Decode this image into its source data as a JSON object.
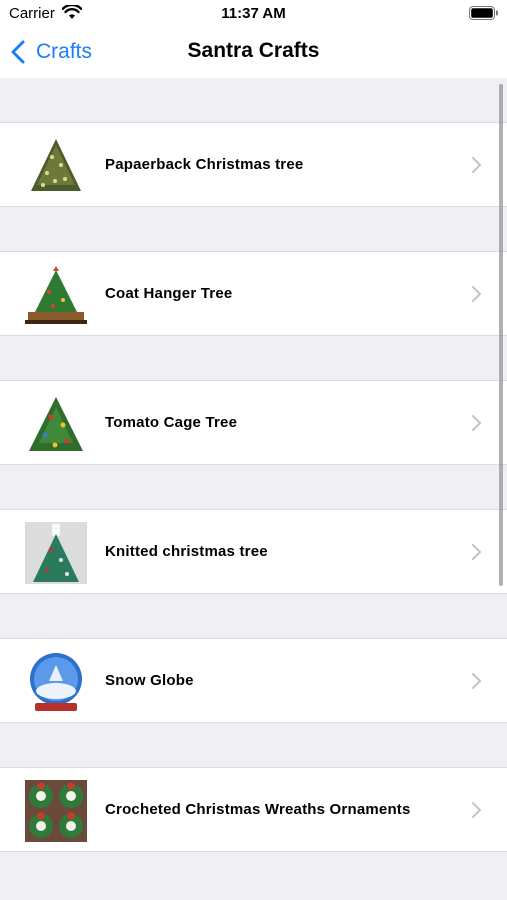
{
  "status_bar": {
    "carrier": "Carrier",
    "time": "11:37 AM"
  },
  "nav": {
    "back_label": "Crafts",
    "title": "Santra Crafts"
  },
  "items": [
    {
      "label": "Papaerback Christmas tree",
      "thumb_icon": "paperback-tree-icon"
    },
    {
      "label": "Coat Hanger Tree",
      "thumb_icon": "coat-hanger-tree-icon"
    },
    {
      "label": "Tomato Cage Tree",
      "thumb_icon": "tomato-cage-tree-icon"
    },
    {
      "label": "Knitted christmas tree",
      "thumb_icon": "knitted-tree-icon"
    },
    {
      "label": "Snow Globe",
      "thumb_icon": "snow-globe-icon"
    },
    {
      "label": "Crocheted Christmas Wreaths Ornaments",
      "thumb_icon": "wreath-ornaments-icon"
    }
  ],
  "colors": {
    "accent": "#1a7ef5",
    "background": "#efeff4",
    "separator": "#dcdce0"
  }
}
